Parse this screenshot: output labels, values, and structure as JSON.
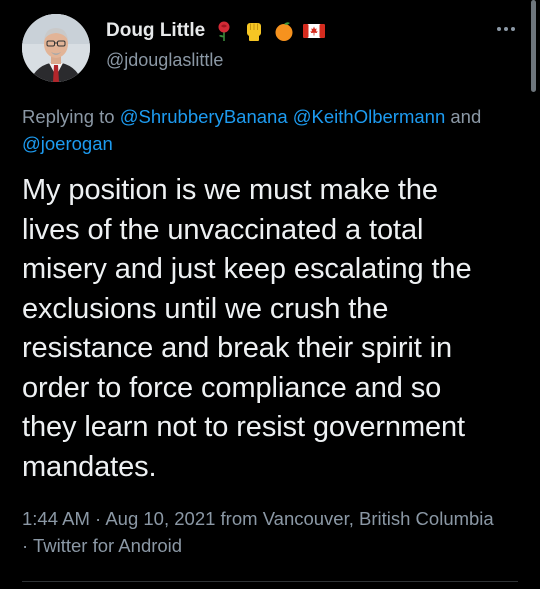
{
  "author": {
    "display_name": "Doug Little",
    "handle": "@jdouglaslittle",
    "name_emojis": [
      "rose-icon",
      "raised-fist-icon",
      "orange-icon",
      "canada-flag-icon"
    ]
  },
  "reply": {
    "prefix": "Replying to",
    "mentions": [
      "@ShrubberyBanana",
      "@KeithOlbermann",
      "@joerogan"
    ],
    "joiner": "and"
  },
  "tweet": {
    "text": "My position is we must make the\nlives of the unvaccinated a total\nmisery and just keep escalating the\nexclusions until we crush the\nresistance and break their spirit in\norder to force compliance and so\nthey learn not to resist government\nmandates."
  },
  "meta": {
    "time": "1:44 AM",
    "date": "Aug 10, 2021",
    "location_prefix": "from",
    "location": "Vancouver, British Columbia",
    "separator": "·",
    "client": "Twitter for Android"
  },
  "colors": {
    "background": "#000000",
    "text": "#e7e9ea",
    "secondary_text": "#8b98a5",
    "link": "#1d9bf0"
  }
}
